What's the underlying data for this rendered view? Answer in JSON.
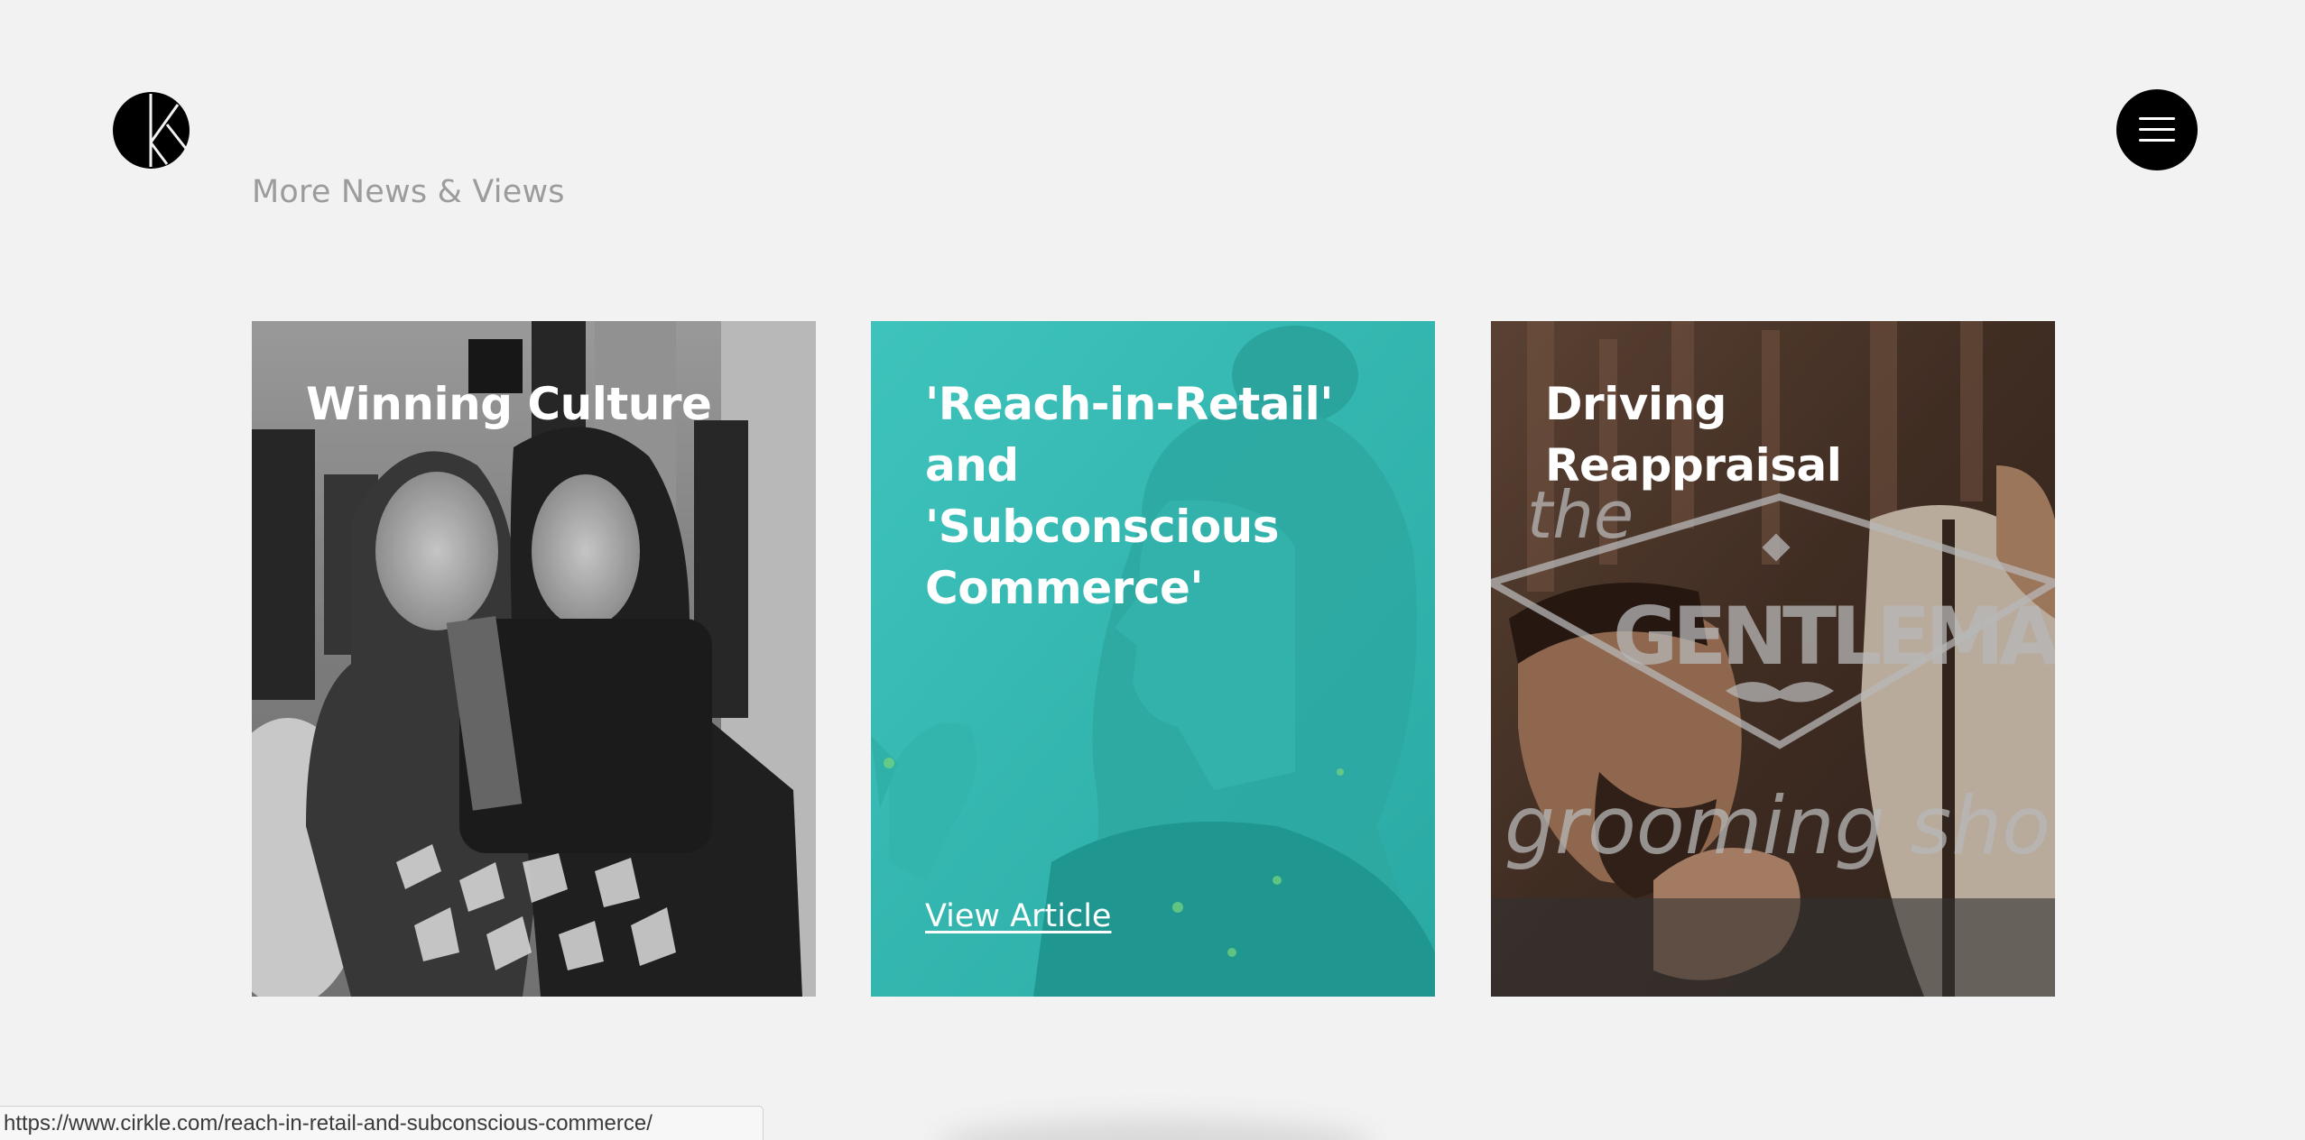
{
  "header": {
    "logo_icon": "cirkle-logo-icon",
    "menu_icon": "hamburger-menu-icon"
  },
  "section": {
    "title": "More News & Views"
  },
  "cards": [
    {
      "title": "Winning Culture",
      "image": "two-women-holding-award-photo",
      "overlay_color": "#000000"
    },
    {
      "title": "'Reach-in-Retail' and 'Subconscious Commerce'",
      "link_label": "View Article",
      "image": "woman-profile-photo",
      "overlay_color": "#2ebdb5"
    },
    {
      "title": "Driving Reappraisal",
      "image": "gentlemans-grooming-show-photo",
      "image_text": [
        "the",
        "GENTLEMAN'S",
        "grooming show"
      ],
      "overlay_color": "#000000"
    }
  ],
  "status_bar": {
    "url": "https://www.cirkle.com/reach-in-retail-and-subconscious-commerce/"
  }
}
